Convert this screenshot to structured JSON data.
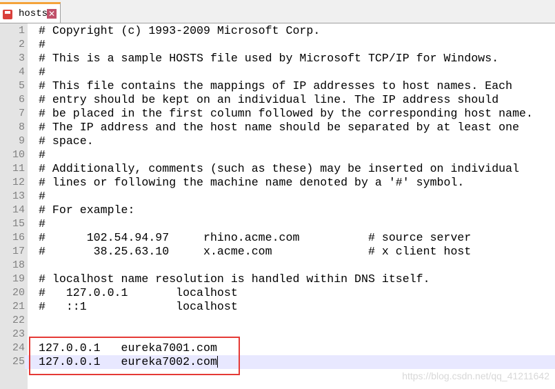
{
  "tab": {
    "title": "hosts",
    "icon": "save-icon",
    "close_icon": "close-icon"
  },
  "editor": {
    "current_line": 25,
    "lines": [
      "# Copyright (c) 1993-2009 Microsoft Corp.",
      "#",
      "# This is a sample HOSTS file used by Microsoft TCP/IP for Windows.",
      "#",
      "# This file contains the mappings of IP addresses to host names. Each",
      "# entry should be kept on an individual line. The IP address should",
      "# be placed in the first column followed by the corresponding host name.",
      "# The IP address and the host name should be separated by at least one",
      "# space.",
      "#",
      "# Additionally, comments (such as these) may be inserted on individual",
      "# lines or following the machine name denoted by a '#' symbol.",
      "#",
      "# For example:",
      "#",
      "#      102.54.94.97     rhino.acme.com          # source server",
      "#       38.25.63.10     x.acme.com              # x client host",
      "",
      "# localhost name resolution is handled within DNS itself.",
      "#\t127.0.0.1       localhost",
      "#\t::1             localhost",
      "",
      "",
      "127.0.0.1   eureka7001.com",
      "127.0.0.1   eureka7002.com"
    ]
  },
  "highlight_color": "#e53935",
  "watermark": "https://blog.csdn.net/qq_41211642"
}
